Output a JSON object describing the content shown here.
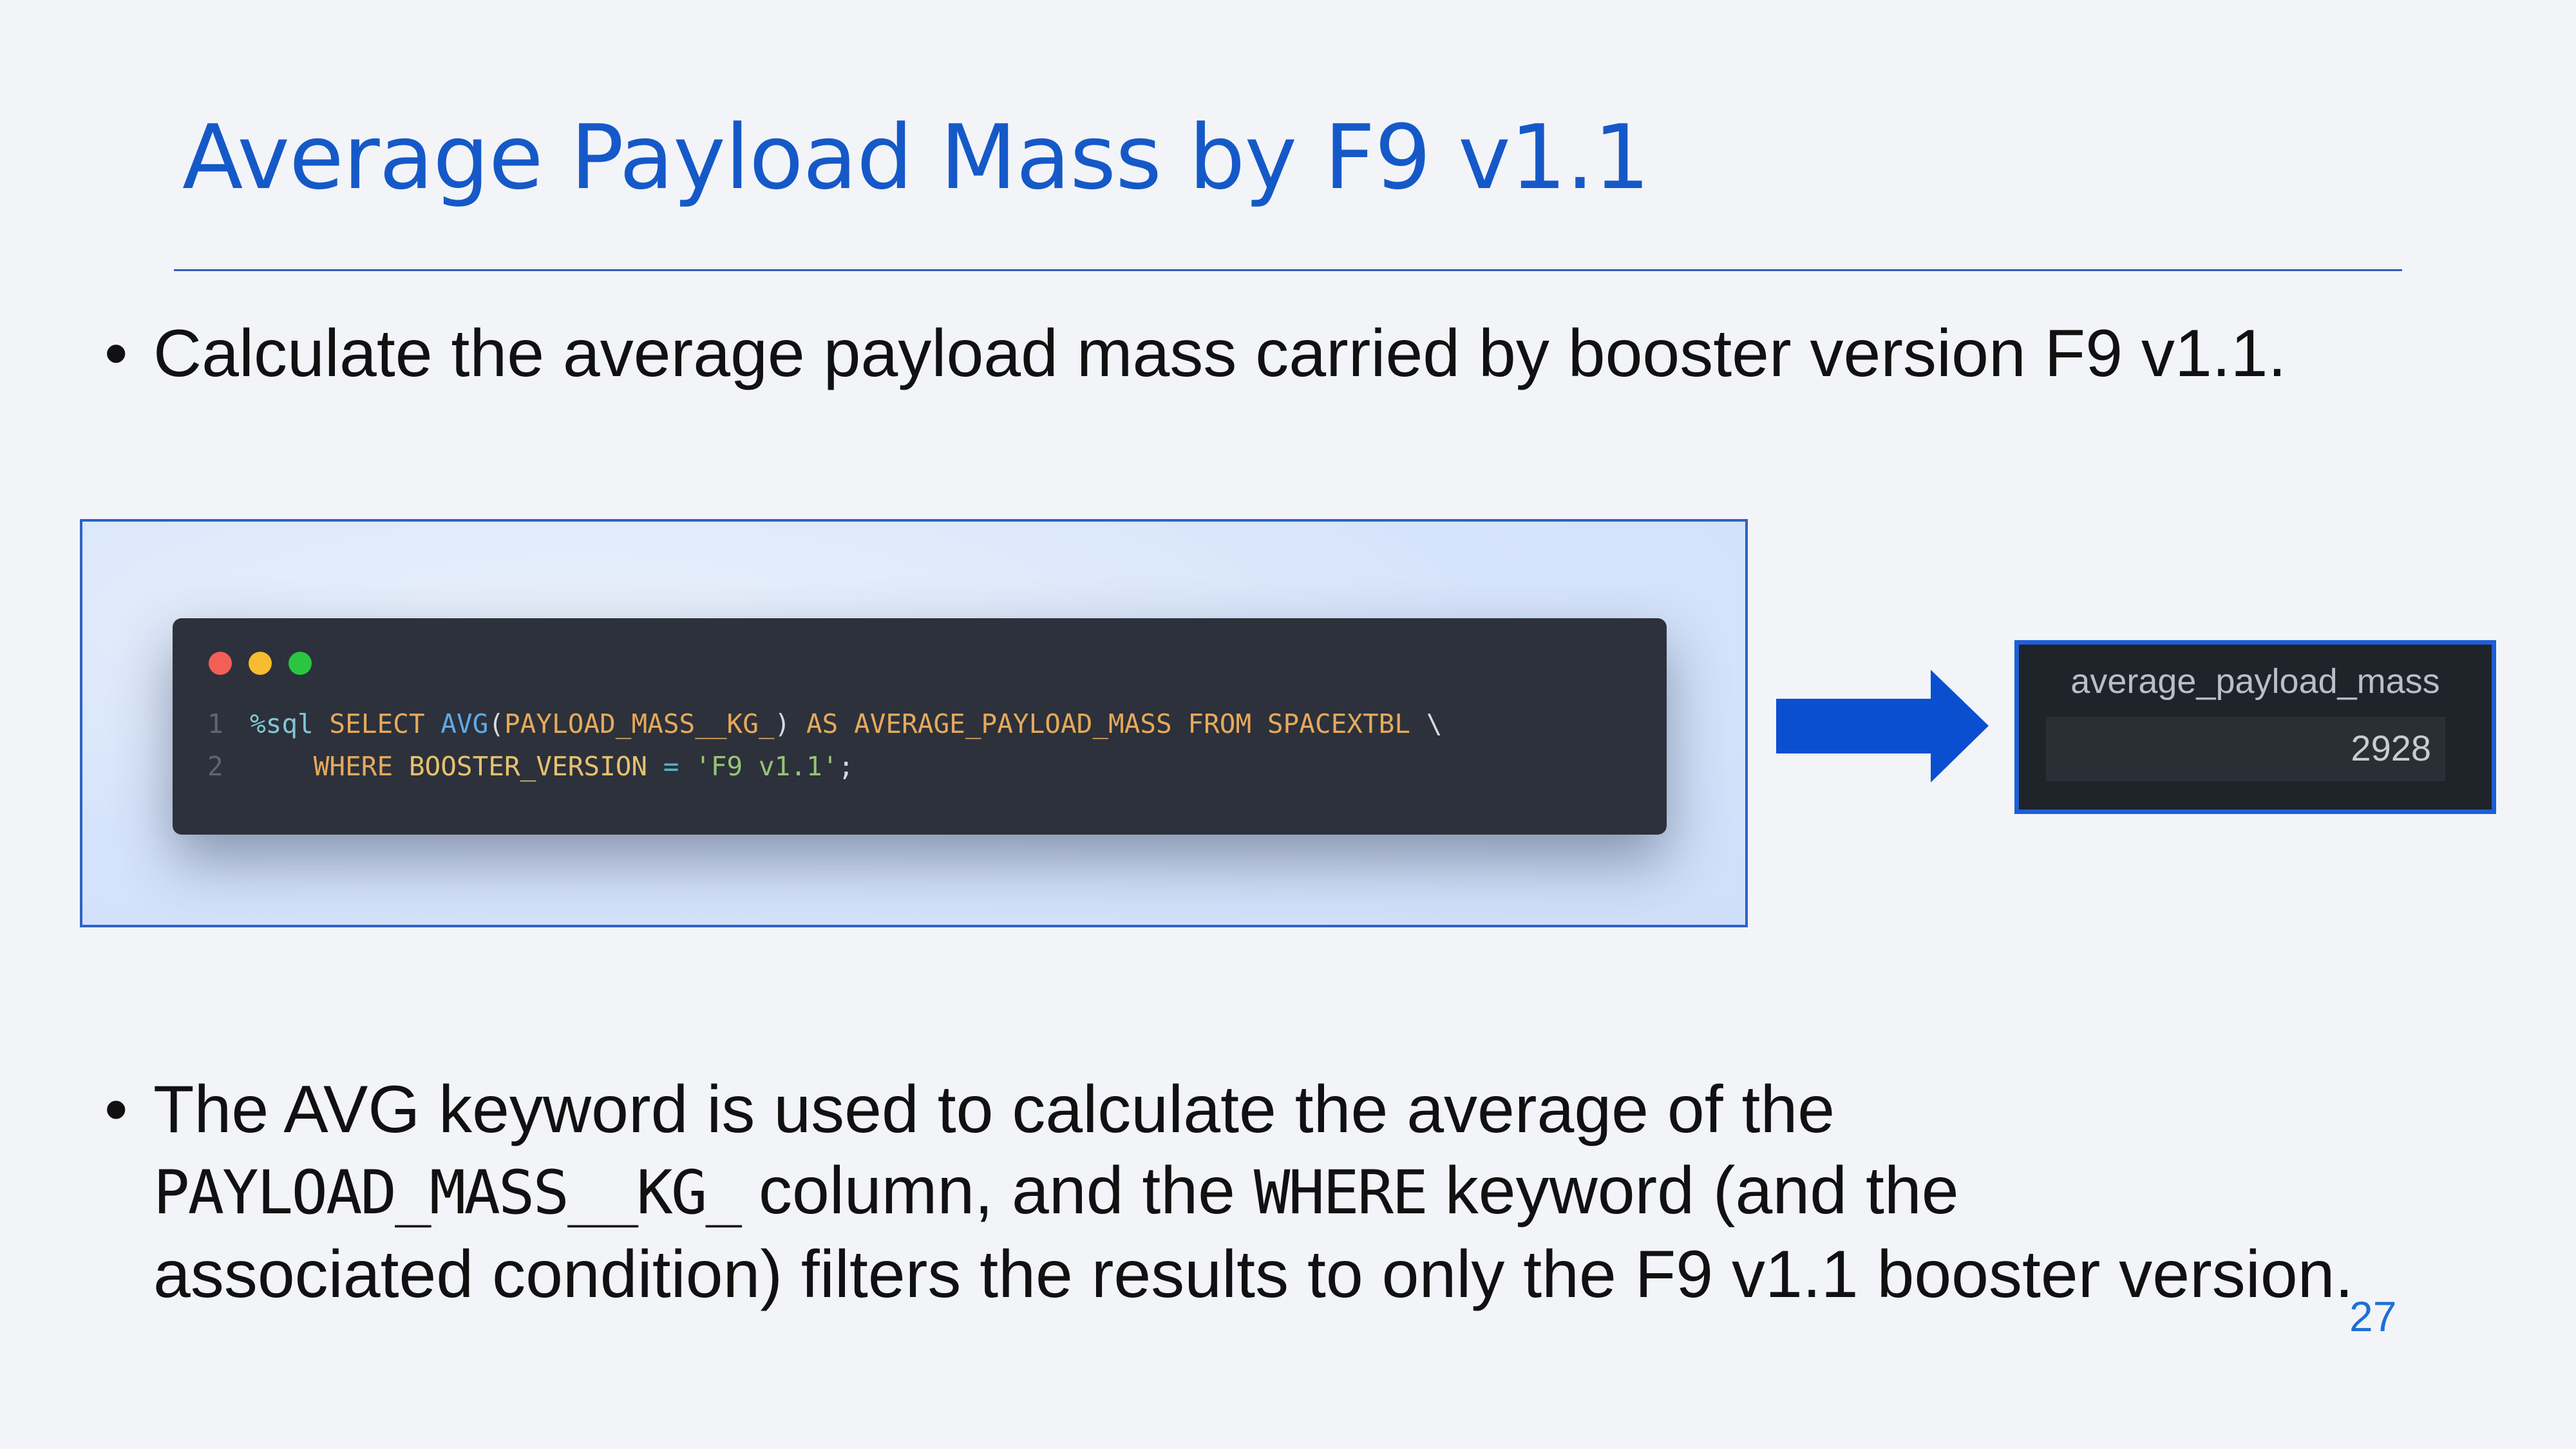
{
  "slide": {
    "title": "Average Payload Mass by F9 v1.1",
    "bullet_symbol": "•",
    "bullet1": "Calculate the average payload mass carried by booster version F9 v1.1.",
    "bullet2": {
      "line1": "The AVG keyword is used to calculate the average of the",
      "line2_code": "PAYLOAD_MASS__KG_",
      "line2_mid": " column, and the ",
      "line2_code2": "WHERE",
      "line2_end": " keyword (and the",
      "line3": "associated condition) filters the results to only the F9 v1.1 booster version."
    },
    "page_number": "27"
  },
  "code": {
    "line_numbers": [
      "1",
      "2"
    ],
    "line1": {
      "magic": "%sql",
      "select": " SELECT ",
      "fn": "AVG",
      "open": "(",
      "col": "PAYLOAD_MASS__KG_",
      "close": ")",
      "as": " AS ",
      "alias": "AVERAGE_PAYLOAD_MASS",
      "from": " FROM ",
      "table": "SPACEXTBL",
      "cont": " \\"
    },
    "line2": {
      "indent": "    ",
      "where": "WHERE ",
      "col": "BOOSTER_VERSION",
      "op": " = ",
      "str": "'F9 v1.1'",
      "semi": ";"
    }
  },
  "result": {
    "column_header": "average_payload_mass",
    "value": "2928"
  },
  "colors": {
    "title": "#1559c8",
    "accent_border": "#1d5fd6",
    "arrow": "#0b4fd1",
    "code_bg": "#2c313b"
  }
}
